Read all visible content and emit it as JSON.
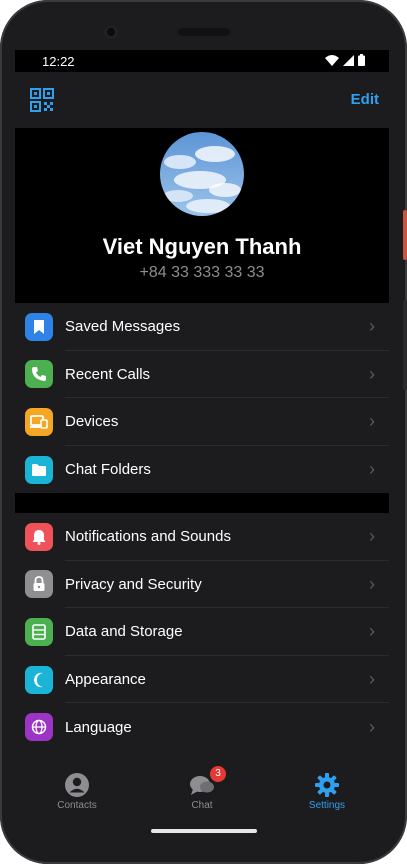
{
  "status": {
    "time": "12:22"
  },
  "header": {
    "edit_label": "Edit"
  },
  "profile": {
    "name": "Viet Nguyen Thanh",
    "phone": "+84 33 333 33 33"
  },
  "group1": [
    {
      "label": "Saved Messages",
      "icon": "bookmark-icon",
      "color": "#2f83e6"
    },
    {
      "label": "Recent Calls",
      "icon": "phone-icon",
      "color": "#4caf50"
    },
    {
      "label": "Devices",
      "icon": "devices-icon",
      "color": "#f5a623"
    },
    {
      "label": "Chat Folders",
      "icon": "folder-icon",
      "color": "#1ab4d6"
    }
  ],
  "group2": [
    {
      "label": "Notifications and Sounds",
      "icon": "bell-icon",
      "color": "#f0525a"
    },
    {
      "label": "Privacy and Security",
      "icon": "lock-icon",
      "color": "#8e8e93"
    },
    {
      "label": "Data and Storage",
      "icon": "storage-icon",
      "color": "#4caf50"
    },
    {
      "label": "Appearance",
      "icon": "moon-icon",
      "color": "#1ab4d6"
    },
    {
      "label": "Language",
      "icon": "globe-icon",
      "color": "#9c35c4"
    }
  ],
  "tabs": [
    {
      "label": "Contacts",
      "icon": "person-icon"
    },
    {
      "label": "Chat",
      "icon": "chat-bubbles-icon",
      "badge": "3"
    },
    {
      "label": "Settings",
      "icon": "gear-icon"
    }
  ],
  "accent": "#2f9ff0"
}
